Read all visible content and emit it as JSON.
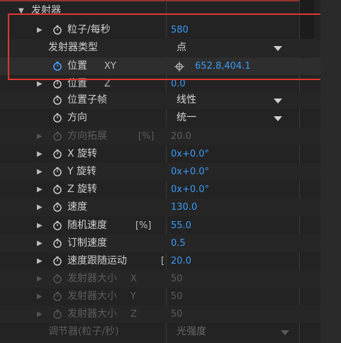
{
  "section": {
    "label": "发射器"
  },
  "rows": [
    {
      "label": "粒子/每秒",
      "value": "580"
    },
    {
      "label": "发射器类型",
      "dropdown": "点"
    },
    {
      "label": "位置",
      "sub": "XY",
      "value": "652.8,404.1"
    },
    {
      "label": "位置",
      "sub": "Z",
      "value": "0.0"
    },
    {
      "label": "位置子帧",
      "dropdown": "线性"
    },
    {
      "label": "方向",
      "dropdown": "统一"
    },
    {
      "label": "方向拓展",
      "sub": "[%]",
      "value": "20.0"
    },
    {
      "label": "X 旋转",
      "value": "0x+0.0°"
    },
    {
      "label": "Y 旋转",
      "value": "0x+0.0°"
    },
    {
      "label": "Z 旋转",
      "value": "0x+0.0°"
    },
    {
      "label": "速度",
      "value": "130.0"
    },
    {
      "label": "随机速度",
      "sub": "[%]",
      "value": "55.0"
    },
    {
      "label": "订制速度",
      "value": "0.5"
    },
    {
      "label": "速度跟随运动",
      "sub": "[",
      "value": "20.0"
    },
    {
      "label": "发射器大小",
      "sub": "X",
      "value": "50"
    },
    {
      "label": "发射器大小",
      "sub": "Y",
      "value": "50"
    },
    {
      "label": "发射器大小",
      "sub": "Z",
      "value": "50"
    },
    {
      "label": "调节器(粒子/秒)",
      "dropdown": "光强度"
    }
  ],
  "icons": {
    "twirl_open": "triangle-down-icon",
    "twirl_closed": "triangle-right-icon",
    "stopwatch": "stopwatch-icon",
    "crosshair": "crosshair-icon",
    "dropdown": "chevron-down-icon"
  },
  "colors": {
    "value": "#3a9af5",
    "highlight": "#e0362f",
    "stopwatch_active": "#4aa0ff"
  }
}
